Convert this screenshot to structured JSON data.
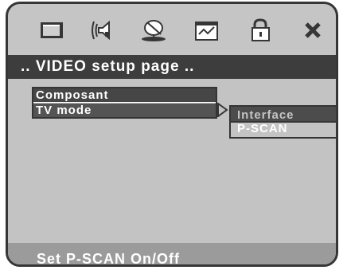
{
  "toolbar": {
    "icons": [
      "monitor-icon",
      "speaker-icon",
      "satellite-dish-icon",
      "checklist-icon",
      "padlock-icon",
      "close-icon"
    ]
  },
  "page_title": ".. VIDEO setup page ..",
  "menu": {
    "items": [
      {
        "label": "Composant"
      },
      {
        "label": "TV mode"
      }
    ]
  },
  "submenu": {
    "items": [
      {
        "label": "Interface"
      },
      {
        "label": "P-SCAN"
      }
    ]
  },
  "status": "Set P-SCAN On/Off",
  "colors": {
    "frame": "#c5c5c5",
    "border": "#363636",
    "title_bar": "#3d3d3d",
    "status_bar": "#9b9b9b"
  }
}
